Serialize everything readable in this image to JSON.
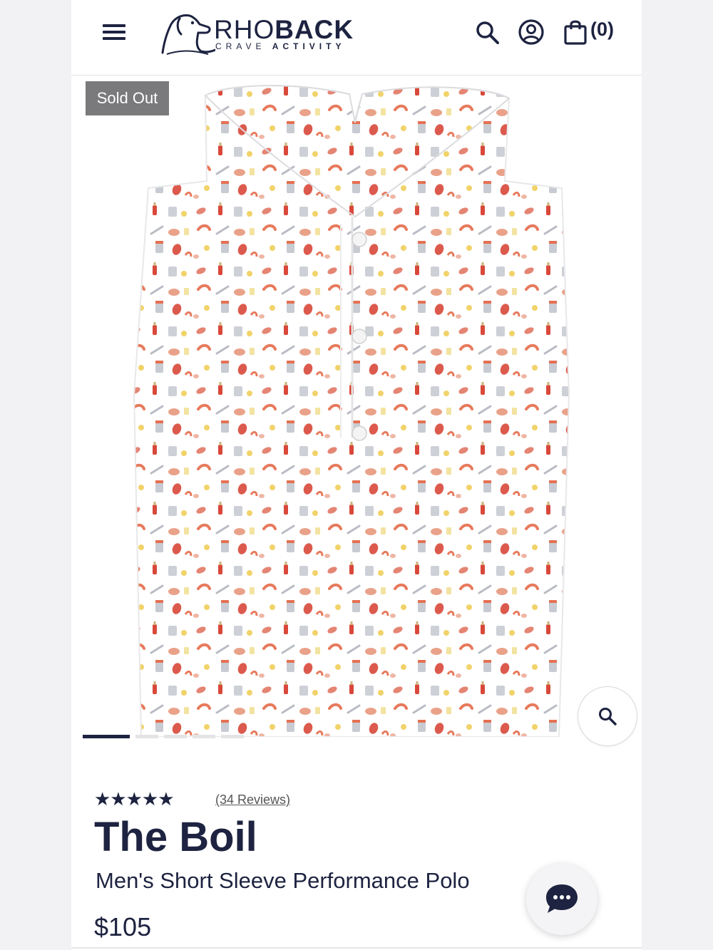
{
  "header": {
    "logo_main_light": "RHO",
    "logo_main_bold": "BACK",
    "logo_tag_light": "CRAVE ",
    "logo_tag_bold": "ACTIVITY",
    "cart_count": "(0)",
    "icons": [
      "menu-icon",
      "search-icon",
      "account-icon",
      "bag-icon"
    ]
  },
  "gallery": {
    "badge": "Sold Out",
    "slide_count": 5,
    "active_slide": 1,
    "zoom_icon": "magnifier-icon"
  },
  "product": {
    "stars": "★★★★★",
    "rating": 5,
    "reviews_label": "(34 Reviews)",
    "name": "The Boil",
    "subtitle": "Men's Short Sleeve Performance Polo",
    "price": "$105"
  },
  "chat": {
    "icon": "chat-bubble-icon"
  },
  "colors": {
    "navy": "#1d2340",
    "badge_gray": "#7a7a7c",
    "page_bg": "#f2f2f4"
  }
}
